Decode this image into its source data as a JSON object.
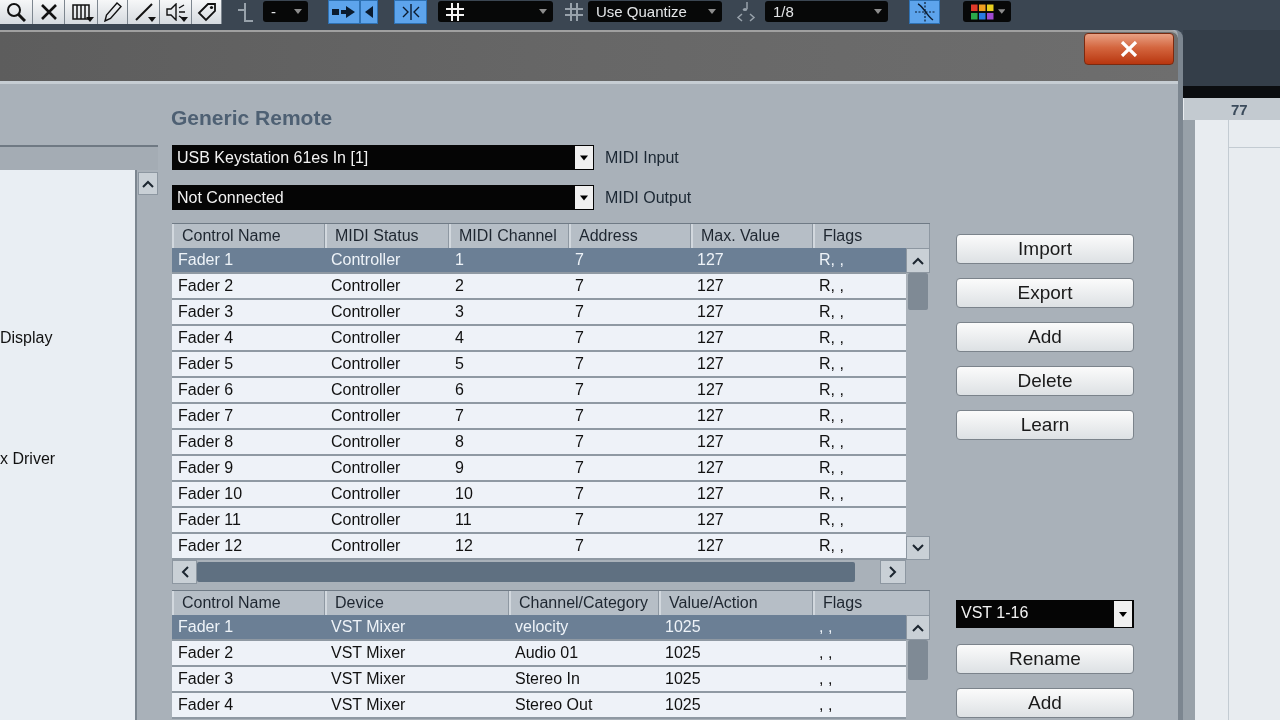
{
  "toolbar": [
    {
      "kind": "icon"
    },
    {
      "kind": "dropdown",
      "value": "-"
    },
    {
      "kind": "toggle",
      "on": true
    },
    {
      "kind": "toggle",
      "on": true
    },
    {
      "kind": "toggle",
      "on": true
    },
    {
      "kind": "icon_dropdown"
    },
    {
      "kind": "icon"
    },
    {
      "kind": "dropdown",
      "value": "Use Quantize"
    },
    {
      "kind": "icon"
    },
    {
      "kind": "dropdown",
      "value": "1/8"
    },
    {
      "kind": "toggle",
      "on": true
    },
    {
      "kind": "icon_dropdown"
    }
  ],
  "dialog": {
    "title": "Generic Remote",
    "device_list": {
      "items": [
        "Display",
        "x Driver"
      ]
    },
    "midi_ports": [
      {
        "value": "USB Keystation 61es In [1]",
        "label": "MIDI Input"
      },
      {
        "value": "Not Connected",
        "label": "MIDI Output"
      }
    ],
    "control_table": {
      "columns": [
        "Control Name",
        "MIDI Status",
        "MIDI Channel",
        "Address",
        "Max. Value",
        "Flags"
      ],
      "rows": [
        {
          "selected": true,
          "cells": [
            "Fader 1",
            "Controller",
            "1",
            "7",
            "127",
            "R, ,"
          ]
        },
        {
          "selected": false,
          "cells": [
            "Fader 2",
            "Controller",
            "2",
            "7",
            "127",
            "R, ,"
          ]
        },
        {
          "selected": false,
          "cells": [
            "Fader 3",
            "Controller",
            "3",
            "7",
            "127",
            "R, ,"
          ]
        },
        {
          "selected": false,
          "cells": [
            "Fader 4",
            "Controller",
            "4",
            "7",
            "127",
            "R, ,"
          ]
        },
        {
          "selected": false,
          "cells": [
            "Fader 5",
            "Controller",
            "5",
            "7",
            "127",
            "R, ,"
          ]
        },
        {
          "selected": false,
          "cells": [
            "Fader 6",
            "Controller",
            "6",
            "7",
            "127",
            "R, ,"
          ]
        },
        {
          "selected": false,
          "cells": [
            "Fader 7",
            "Controller",
            "7",
            "7",
            "127",
            "R, ,"
          ]
        },
        {
          "selected": false,
          "cells": [
            "Fader 8",
            "Controller",
            "8",
            "7",
            "127",
            "R, ,"
          ]
        },
        {
          "selected": false,
          "cells": [
            "Fader 9",
            "Controller",
            "9",
            "7",
            "127",
            "R, ,"
          ]
        },
        {
          "selected": false,
          "cells": [
            "Fader 10",
            "Controller",
            "10",
            "7",
            "127",
            "R, ,"
          ]
        },
        {
          "selected": false,
          "cells": [
            "Fader 11",
            "Controller",
            "11",
            "7",
            "127",
            "R, ,"
          ]
        },
        {
          "selected": false,
          "cells": [
            "Fader 12",
            "Controller",
            "12",
            "7",
            "127",
            "R, ,"
          ]
        }
      ]
    },
    "control_buttons": [
      "Import",
      "Export",
      "Add",
      "Delete",
      "Learn"
    ],
    "bank": {
      "value": "VST 1-16"
    },
    "assignment_table": {
      "columns": [
        "Control Name",
        "Device",
        "Channel/Category",
        "Value/Action",
        "Flags"
      ],
      "rows": [
        {
          "selected": true,
          "cells": [
            "Fader 1",
            "VST Mixer",
            "velocity",
            "1025",
            ", ,"
          ]
        },
        {
          "selected": false,
          "cells": [
            "Fader 2",
            "VST Mixer",
            "Audio 01",
            "1025",
            ", ,"
          ]
        },
        {
          "selected": false,
          "cells": [
            "Fader 3",
            "VST Mixer",
            "Stereo In",
            "1025",
            ", ,"
          ]
        },
        {
          "selected": false,
          "cells": [
            "Fader 4",
            "VST Mixer",
            "Stereo Out",
            "1025",
            ", ,"
          ]
        }
      ]
    },
    "bank_buttons": [
      "Rename",
      "Add"
    ]
  },
  "project": {
    "ruler_label": "77"
  }
}
